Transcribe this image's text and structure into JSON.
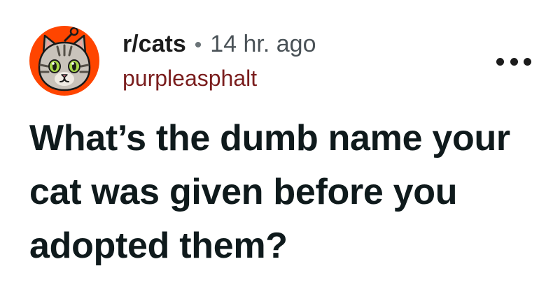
{
  "post": {
    "subreddit": "r/cats",
    "separator": "•",
    "timestamp": "14 hr. ago",
    "username": "purpleasphalt",
    "title": "What’s the dumb name your cat was given before you adopted them?",
    "avatar_icon": "cat-avatar-icon",
    "menu_icon": "more-options-icon"
  },
  "colors": {
    "avatar_bg": "#ff4500",
    "username": "#7a1d1d",
    "text": "#0f1a1c"
  }
}
